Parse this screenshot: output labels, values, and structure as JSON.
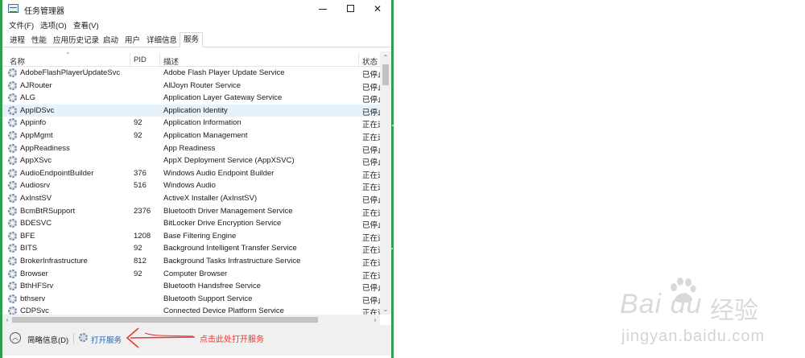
{
  "window": {
    "title": "任务管理器",
    "controls": {
      "minimize": "—",
      "maximize": "☐",
      "close": "✕"
    }
  },
  "menu": [
    {
      "label": "文件(F)"
    },
    {
      "label": "选项(O)"
    },
    {
      "label": "查看(V)"
    }
  ],
  "tabs": [
    {
      "label": "进程"
    },
    {
      "label": "性能"
    },
    {
      "label": "应用历史记录"
    },
    {
      "label": "启动"
    },
    {
      "label": "用户"
    },
    {
      "label": "详细信息"
    },
    {
      "label": "服务",
      "active": true
    }
  ],
  "columns": {
    "name": "名称",
    "pid": "PID",
    "desc": "描述",
    "status": "状态"
  },
  "rows": [
    {
      "name": "AdobeFlashPlayerUpdateSvc",
      "pid": "",
      "desc": "Adobe Flash Player Update Service",
      "status": "已停止"
    },
    {
      "name": "AJRouter",
      "pid": "",
      "desc": "AllJoyn Router Service",
      "status": "已停止"
    },
    {
      "name": "ALG",
      "pid": "",
      "desc": "Application Layer Gateway Service",
      "status": "已停止"
    },
    {
      "name": "AppIDSvc",
      "pid": "",
      "desc": "Application Identity",
      "status": "已停止",
      "selected": true
    },
    {
      "name": "Appinfo",
      "pid": "92",
      "desc": "Application Information",
      "status": "正在运行"
    },
    {
      "name": "AppMgmt",
      "pid": "92",
      "desc": "Application Management",
      "status": "正在运行"
    },
    {
      "name": "AppReadiness",
      "pid": "",
      "desc": "App Readiness",
      "status": "已停止"
    },
    {
      "name": "AppXSvc",
      "pid": "",
      "desc": "AppX Deployment Service (AppXSVC)",
      "status": "已停止"
    },
    {
      "name": "AudioEndpointBuilder",
      "pid": "376",
      "desc": "Windows Audio Endpoint Builder",
      "status": "正在运行"
    },
    {
      "name": "Audiosrv",
      "pid": "516",
      "desc": "Windows Audio",
      "status": "正在运行"
    },
    {
      "name": "AxInstSV",
      "pid": "",
      "desc": "ActiveX Installer (AxInstSV)",
      "status": "已停止"
    },
    {
      "name": "BcmBtRSupport",
      "pid": "2376",
      "desc": "Bluetooth Driver Management Service",
      "status": "正在运行"
    },
    {
      "name": "BDESVC",
      "pid": "",
      "desc": "BitLocker Drive Encryption Service",
      "status": "已停止"
    },
    {
      "name": "BFE",
      "pid": "1208",
      "desc": "Base Filtering Engine",
      "status": "正在运行"
    },
    {
      "name": "BITS",
      "pid": "92",
      "desc": "Background Intelligent Transfer Service",
      "status": "正在运行"
    },
    {
      "name": "BrokerInfrastructure",
      "pid": "812",
      "desc": "Background Tasks Infrastructure Service",
      "status": "正在运行"
    },
    {
      "name": "Browser",
      "pid": "92",
      "desc": "Computer Browser",
      "status": "正在运行"
    },
    {
      "name": "BthHFSrv",
      "pid": "",
      "desc": "Bluetooth Handsfree Service",
      "status": "已停止"
    },
    {
      "name": "bthserv",
      "pid": "",
      "desc": "Bluetooth Support Service",
      "status": "已停止"
    },
    {
      "name": "CDPSvc",
      "pid": "",
      "desc": "Connected Device Platform Service",
      "status": "正在运行"
    }
  ],
  "footer": {
    "fewer_details": "简略信息(D)",
    "open_services": "打开服务"
  },
  "annotation": {
    "note": "点击此处打开服务",
    "color": "#e53935"
  },
  "watermark": {
    "brand_latin": "Bai du",
    "brand_cn": "经验",
    "url": "jingyan.baidu.com"
  },
  "colors": {
    "window_border": "#2f9e4f",
    "selected_row": "#e5f1fb",
    "link": "#1565c0"
  },
  "icons": {
    "app": "task-manager-icon",
    "service": "gear-icon",
    "collapse": "chevron-up-icon"
  }
}
